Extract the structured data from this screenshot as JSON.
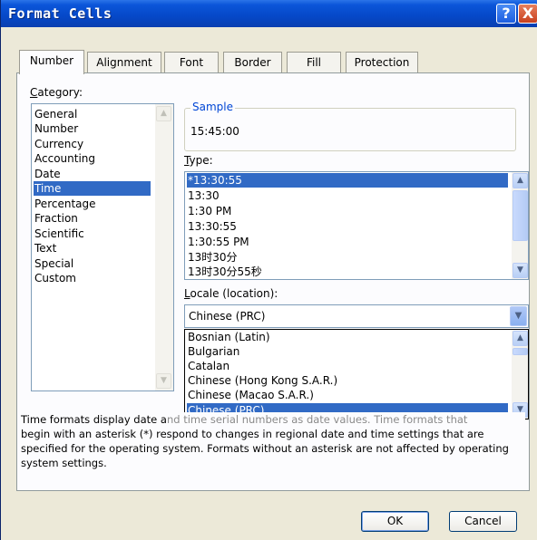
{
  "window": {
    "title": "Format Cells"
  },
  "titlebar_buttons": {
    "help": "?",
    "close": "X"
  },
  "tabs": [
    {
      "label": "Number",
      "active": true
    },
    {
      "label": "Alignment",
      "active": false
    },
    {
      "label": "Font",
      "active": false
    },
    {
      "label": "Border",
      "active": false
    },
    {
      "label": "Fill",
      "active": false
    },
    {
      "label": "Protection",
      "active": false
    }
  ],
  "category": {
    "label_u": "C",
    "label_rest": "ategory:",
    "items": [
      "General",
      "Number",
      "Currency",
      "Accounting",
      "Date",
      "Time",
      "Percentage",
      "Fraction",
      "Scientific",
      "Text",
      "Special",
      "Custom"
    ],
    "selected": "Time"
  },
  "sample": {
    "legend": "Sample",
    "value": "15:45:00"
  },
  "type": {
    "label_u": "T",
    "label_rest": "ype:",
    "items": [
      "*13:30:55",
      "13:30",
      "1:30 PM",
      "13:30:55",
      "1:30:55 PM",
      "13时30分",
      "13时30分55秒"
    ],
    "selected": "*13:30:55"
  },
  "locale": {
    "label_u": "L",
    "label_rest": "ocale (location):",
    "value": "Chinese (PRC)",
    "items": [
      "Bosnian (Latin)",
      "Bulgarian",
      "Catalan",
      "Chinese (Hong Kong S.A.R.)",
      "Chinese (Macao S.A.R.)",
      "Chinese (PRC)"
    ],
    "selected": "Chinese (PRC)"
  },
  "description": {
    "line1_a": "Time formats display date a",
    "line1_b": "nd time serial numbers as date values.  Time formats that",
    "rest": "begin with an asterisk (*) respond to changes in regional date and time settings that are specified for the operating system. Formats without an asterisk are not affected by operating system settings."
  },
  "buttons": {
    "ok": "OK",
    "cancel": "Cancel"
  },
  "icons": {
    "scroll_up": "▲",
    "scroll_down": "▼",
    "combo_down": "▼"
  },
  "colors": {
    "selection": "#316ac5",
    "titlebar": "#0548c8",
    "dialog_bg": "#ece9d8"
  }
}
